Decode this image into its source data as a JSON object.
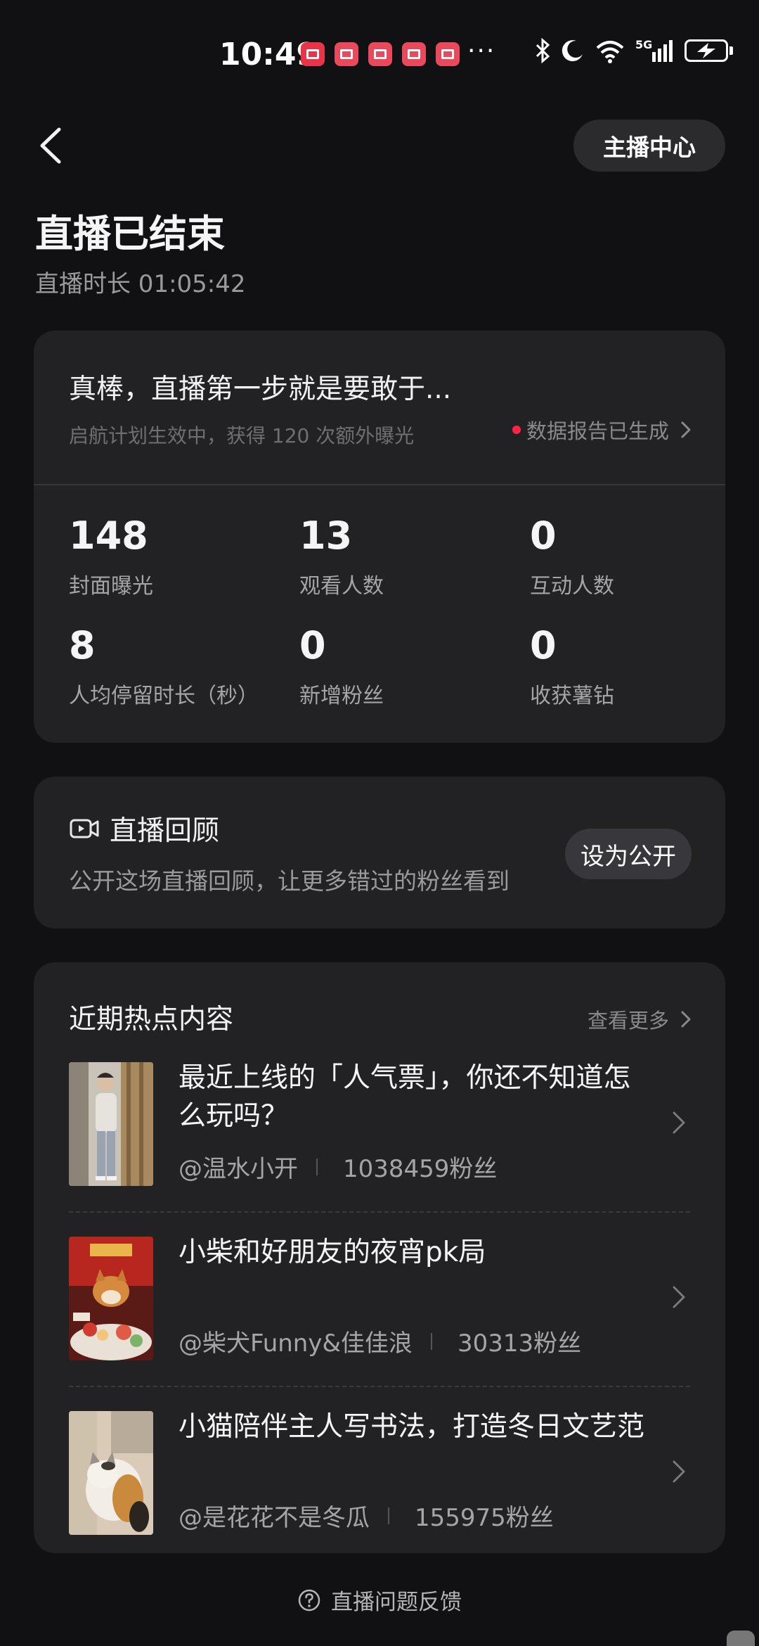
{
  "status_bar": {
    "time": "10:49",
    "dots": "···",
    "network": "5G"
  },
  "header": {
    "anchor_center_label": "主播中心",
    "title": "直播已结束",
    "duration": "直播时长 01:05:42"
  },
  "summary": {
    "headline": "真棒，直播第一步就是要敢于...",
    "subtext": "启航计划生效中，获得 120 次额外曝光",
    "report_label": "数据报告已生成",
    "report_dot_color": "#ff2442",
    "stats": [
      {
        "value": "148",
        "label": "封面曝光"
      },
      {
        "value": "13",
        "label": "观看人数"
      },
      {
        "value": "0",
        "label": "互动人数"
      },
      {
        "value": "8",
        "label": "人均停留时长（秒）"
      },
      {
        "value": "0",
        "label": "新增粉丝"
      },
      {
        "value": "0",
        "label": "收获薯钻"
      }
    ]
  },
  "replay": {
    "title": "直播回顾",
    "description": "公开这场直播回顾，让更多错过的粉丝看到",
    "button_label": "设为公开"
  },
  "hot": {
    "title": "近期热点内容",
    "see_more": "查看更多",
    "items": [
      {
        "title": "最近上线的「人气票」，你还不知道怎么玩吗？",
        "author": "@温水小开",
        "fans": "1038459粉丝"
      },
      {
        "title": "小柴和好朋友的夜宵pk局",
        "author": "@柴犬Funny&佳佳浪",
        "fans": "30313粉丝"
      },
      {
        "title": "小猫陪伴主人写书法，打造冬日文艺范",
        "author": "@是花花不是冬瓜",
        "fans": "155975粉丝"
      }
    ]
  },
  "footer": {
    "feedback": "直播问题反馈"
  }
}
